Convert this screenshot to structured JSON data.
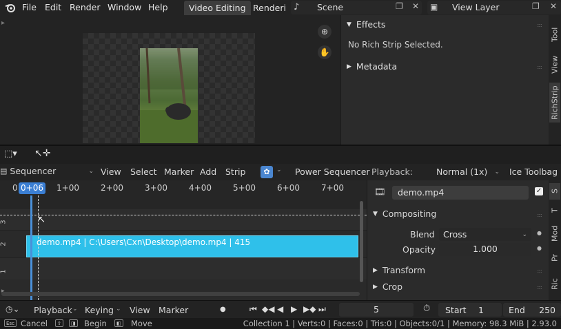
{
  "menu": {
    "file": "File",
    "edit": "Edit",
    "render": "Render",
    "window": "Window",
    "help": "Help"
  },
  "workspaces": {
    "active": "Video Editing",
    "next": "Renderi"
  },
  "scene": {
    "label": "Scene"
  },
  "view_layer": {
    "label": "View Layer"
  },
  "panel": {
    "effects": "Effects",
    "no_strip": "No Rich Strip Selected.",
    "metadata": "Metadata",
    "tabs": [
      "Tool",
      "View",
      "RichStrip"
    ]
  },
  "sequencer_header": {
    "editor": "Sequencer",
    "view": "View",
    "select": "Select",
    "marker": "Marker",
    "add": "Add",
    "strip": "Strip",
    "power": "Power Sequencer",
    "playback_label": "Playback:",
    "speed": "Normal (1x)",
    "ice": "Ice Toolbag"
  },
  "timeline": {
    "current_frame": "0+06",
    "ticks": [
      "0",
      "1+00",
      "2+00",
      "3+00",
      "4+00",
      "5+00",
      "6+00",
      "7+00"
    ],
    "channels": [
      "3",
      "2",
      "1"
    ],
    "strip_label": "demo.mp4 | C:\\Users\\Cxn\\Desktop\\demo.mp4 | 415"
  },
  "strip_props": {
    "name": "demo.mp4",
    "compositing": "Compositing",
    "blend_label": "Blend",
    "blend_value": "Cross",
    "opacity_label": "Opacity",
    "opacity_value": "1.000",
    "transform": "Transform",
    "crop": "Crop",
    "tabs": [
      "S",
      "T",
      "Mod",
      "Pr",
      "Ric"
    ]
  },
  "playback_bar": {
    "playback": "Playback",
    "keying": "Keying",
    "view": "View",
    "marker": "Marker",
    "frame": "5",
    "start_label": "Start",
    "start_value": "1",
    "end_label": "End",
    "end_value": "250"
  },
  "status": {
    "key_esc": "Esc",
    "cancel": "Cancel",
    "begin": "Begin",
    "move": "Move",
    "info": "Collection 1 | Verts:0 | Faces:0 | Tris:0 | Objects:0/1 | Memory: 98.3 MiB | 2.93.0"
  },
  "colors": {
    "accent": "#3b7fd4",
    "strip": "#2fc0ea",
    "panel_bg": "#2b2b2b"
  }
}
